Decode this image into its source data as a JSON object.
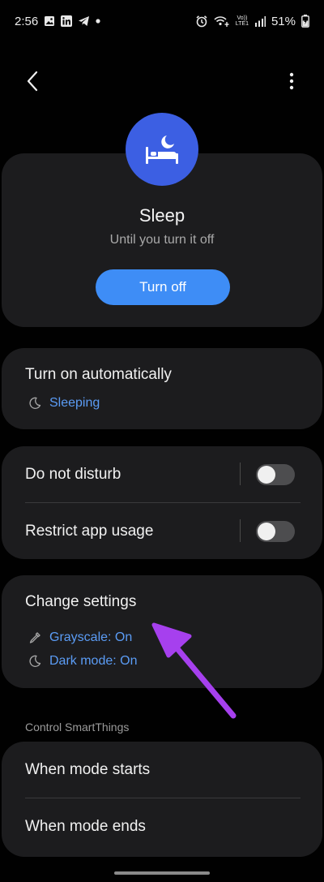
{
  "status_bar": {
    "time": "2:56",
    "volte_label": "Vo))",
    "lte_label": "LTE1",
    "battery": "51%"
  },
  "mode": {
    "title": "Sleep",
    "subtitle": "Until you turn it off",
    "turn_off_label": "Turn off",
    "icon": "bed-moon-icon"
  },
  "auto_section": {
    "title": "Turn on automatically",
    "schedule_label": "Sleeping",
    "schedule_icon": "moon-icon"
  },
  "toggles": [
    {
      "label": "Do not disturb",
      "on": false
    },
    {
      "label": "Restrict app usage",
      "on": false
    }
  ],
  "change_settings": {
    "title": "Change settings",
    "items": [
      {
        "label": "Grayscale: On",
        "icon": "eyedropper-icon"
      },
      {
        "label": "Dark mode: On",
        "icon": "moon-icon"
      }
    ]
  },
  "smartthings": {
    "section_label": "Control SmartThings",
    "items": [
      {
        "label": "When mode starts"
      },
      {
        "label": "When mode ends"
      }
    ]
  },
  "colors": {
    "background": "#010101",
    "card": "#1c1c1e",
    "accent_blue": "#3e8df6",
    "link_blue": "#5b9cf5",
    "avatar_blue": "#3c5fe3",
    "annotation_purple": "#a640ee"
  }
}
